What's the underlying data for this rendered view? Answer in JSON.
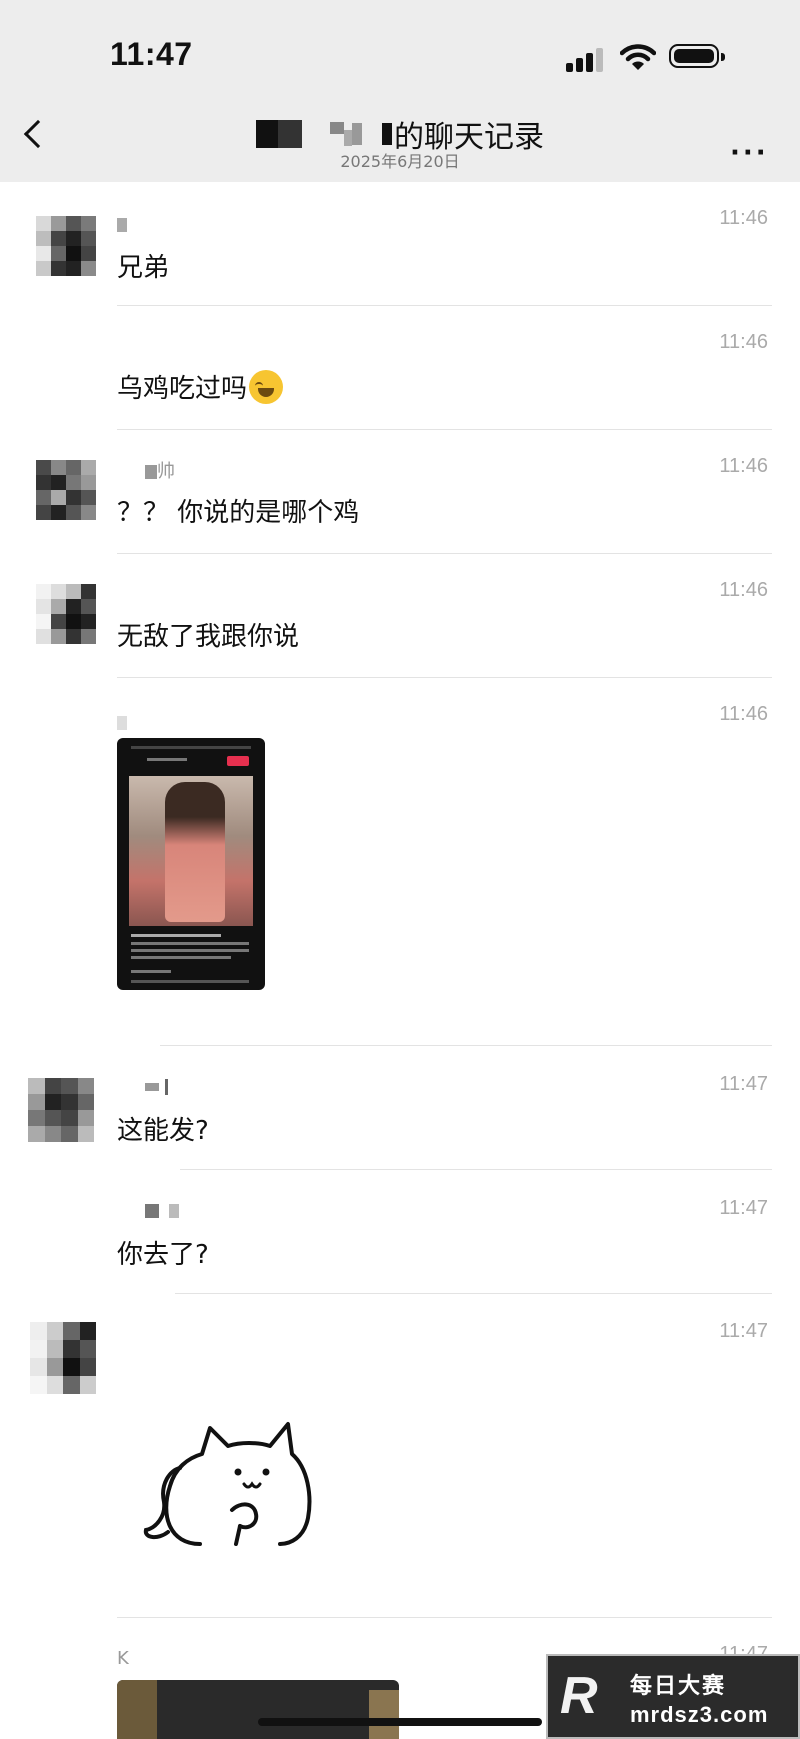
{
  "status_bar": {
    "time": "11:47"
  },
  "nav": {
    "title": "的聊天记录",
    "subtitle": "2025年6月20日",
    "more_label": "···"
  },
  "messages": [
    {
      "sender": "",
      "time": "11:46",
      "text": "兄弟"
    },
    {
      "sender": "",
      "time": "11:46",
      "text": "乌鸡吃过吗"
    },
    {
      "sender": "帅",
      "time": "11:46",
      "text": "？？ 你说的是哪个鸡"
    },
    {
      "sender": "",
      "time": "11:46",
      "text": "无敌了我跟你说"
    },
    {
      "sender": "",
      "time": "11:46",
      "text": ""
    },
    {
      "sender": "",
      "time": "11:47",
      "text": "这能发?"
    },
    {
      "sender": "",
      "time": "11:47",
      "text": "你去了?"
    },
    {
      "sender": "",
      "time": "11:47",
      "text": ""
    },
    {
      "sender": "K",
      "time": "11:47",
      "text": ""
    }
  ],
  "watermark": {
    "brand": "每日大赛",
    "url": "mrdsz3.com",
    "letter": "R"
  }
}
